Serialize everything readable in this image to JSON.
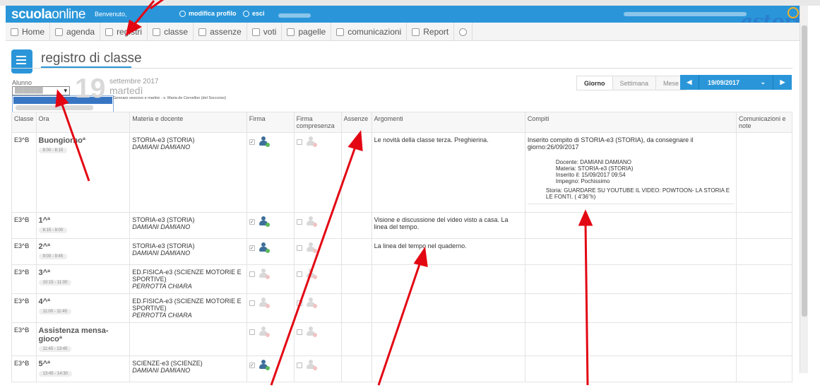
{
  "header": {
    "logo_bold": "scuola",
    "logo_light": "online",
    "welcome": "Benvenuto,",
    "profile_label": "modifica profilo",
    "logout_label": "esci",
    "brand": "astori"
  },
  "menu": [
    {
      "label": "Home",
      "icon": "home-icon"
    },
    {
      "label": "agenda",
      "icon": "calendar-icon"
    },
    {
      "label": "registri",
      "icon": "book-icon"
    },
    {
      "label": "classe",
      "icon": "users-icon"
    },
    {
      "label": "assenze",
      "icon": "user-icon"
    },
    {
      "label": "voti",
      "icon": "edit-icon"
    },
    {
      "label": "pagelle",
      "icon": "report-card-icon"
    },
    {
      "label": "comunicazioni",
      "icon": "mail-icon"
    },
    {
      "label": "Report",
      "icon": "gear-icon"
    },
    {
      "label": "",
      "icon": "help-icon"
    }
  ],
  "page": {
    "title": "registro di classe",
    "alunno_label": "Alunno",
    "day_number": "19",
    "month_year": "settembre 2017",
    "weekday": "martedì",
    "saint": "Gennaro vescovo e martire - s. Maria de Cervellon (del Soccorso)",
    "views": [
      "Giorno",
      "Settimana",
      "Mese"
    ],
    "active_view": "Giorno",
    "date": "19/09/2017"
  },
  "table": {
    "headers": [
      "Classe",
      "Ora",
      "Materia e docente",
      "Firma",
      "Firma compresenza",
      "Assenze",
      "Argomenti",
      "Compiti",
      "Comunicazioni e note"
    ],
    "rows": [
      {
        "classe": "E3^B",
        "ora": "Buongiornoª",
        "time": "8:00 - 8:15",
        "materia": "STORIA-e3 (STORIA)",
        "docente": "DAMIANI DAMIANO",
        "firma": true,
        "argomenti": "Le novità della classe terza. Preghierina.",
        "compiti": "Inserito compito di STORIA-e3 (STORIA), da consegnare il giorno:26/09/2017",
        "compito_details": {
          "docente": "Docente:  DAMIANI DAMIANO",
          "materia": "Materia:   STORIA-e3 (STORIA)",
          "inserito": "Inserito il: 15/09/2017 09:54",
          "impegno": "Impegno: Pochissimo",
          "storia": "Storia: GUARDARE SU YOUTUBE IL VIDEO: POWTOON- LA STORIA E LE FONTI. ( 4'36''h)"
        }
      },
      {
        "classe": "E3^B",
        "ora": "1^ª",
        "time": "8:15 - 9:00",
        "materia": "STORIA-e3 (STORIA)",
        "docente": "DAMIANI DAMIANO",
        "firma": true,
        "argomenti": "Visione e discussione del video visto a casa. La linea del tempo.",
        "compiti": ""
      },
      {
        "classe": "E3^B",
        "ora": "2^ª",
        "time": "9:00 - 9:45",
        "materia": "STORIA-e3 (STORIA)",
        "docente": "DAMIANI DAMIANO",
        "firma": true,
        "argomenti": "La linea del tempo nel quaderno.",
        "compiti": ""
      },
      {
        "classe": "E3^B",
        "ora": "3^ª",
        "time": "10:15 - 11:00",
        "materia": "ED.FISICA-e3 (SCIENZE MOTORIE E SPORTIVE)",
        "docente": "PERROTTA CHIARA",
        "firma": false,
        "argomenti": "",
        "compiti": ""
      },
      {
        "classe": "E3^B",
        "ora": "4^ª",
        "time": "11:00 - 11:45",
        "materia": "ED.FISICA-e3 (SCIENZE MOTORIE E SPORTIVE)",
        "docente": "PERROTTA CHIARA",
        "firma": false,
        "argomenti": "",
        "compiti": ""
      },
      {
        "classe": "E3^B",
        "ora": "Assistenza mensa-giocoª",
        "time": "11:45 - 13:45",
        "materia": "",
        "docente": "",
        "firma": false,
        "argomenti": "",
        "compiti": ""
      },
      {
        "classe": "E3^B",
        "ora": "5^ª",
        "time": "13:45 - 14:30",
        "materia": "SCIENZE-e3 (SCIENZE)",
        "docente": "DAMIANI DAMIANO",
        "firma": true,
        "argomenti": "",
        "compiti": ""
      }
    ]
  },
  "colors": {
    "accent": "#2a96d9",
    "arrow": "#e30613"
  }
}
